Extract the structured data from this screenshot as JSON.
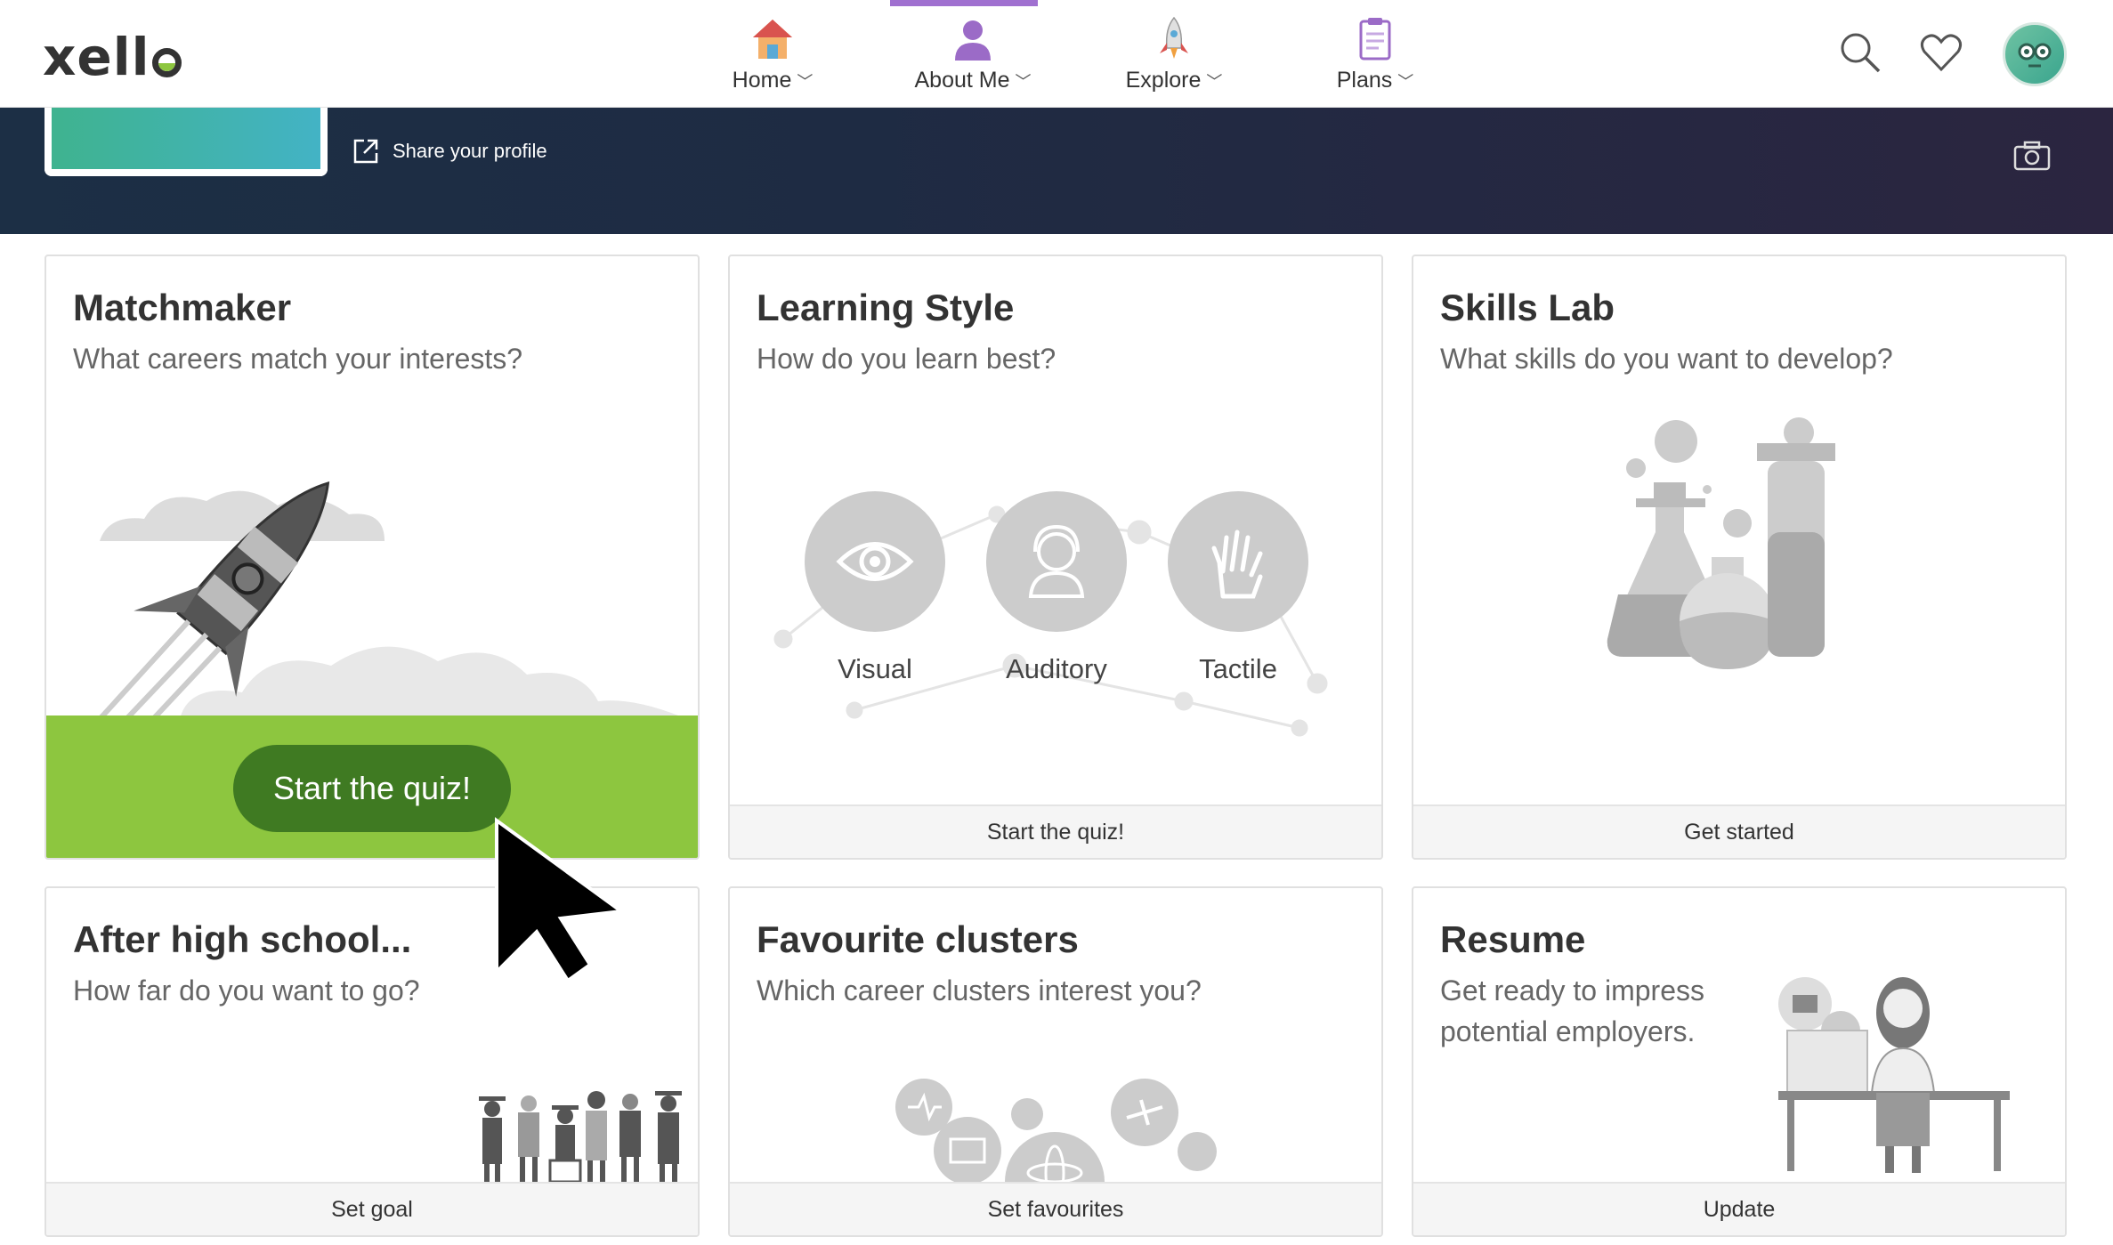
{
  "app": {
    "logo": "xello"
  },
  "nav": {
    "items": [
      {
        "label": "Home",
        "icon": "house-icon"
      },
      {
        "label": "About Me",
        "icon": "person-icon"
      },
      {
        "label": "Explore",
        "icon": "rocket-icon"
      },
      {
        "label": "Plans",
        "icon": "clipboard-icon"
      }
    ],
    "active": "About Me",
    "accent": "#a070d0"
  },
  "banner": {
    "share_label": "Share your profile"
  },
  "cards": {
    "matchmaker": {
      "title": "Matchmaker",
      "subtitle": "What careers match your interests?",
      "button": "Start the quiz!"
    },
    "learning": {
      "title": "Learning Style",
      "subtitle": "How do you learn best?",
      "styles": [
        "Visual",
        "Auditory",
        "Tactile"
      ],
      "footer": "Start the quiz!"
    },
    "skills": {
      "title": "Skills Lab",
      "subtitle": "What skills do you want to develop?",
      "footer": "Get started"
    },
    "after": {
      "title": "After high school...",
      "subtitle": "How far do you want to go?",
      "footer": "Set goal"
    },
    "clusters": {
      "title": "Favourite clusters",
      "subtitle": "Which career clusters interest you?",
      "footer": "Set favourites"
    },
    "resume": {
      "title": "Resume",
      "subtitle_line1": "Get ready to impress",
      "subtitle_line2": "potential employers.",
      "footer": "Update"
    }
  },
  "colors": {
    "green": "#8dc63f",
    "dark_green": "#3f7a22",
    "banner": "#1e2b43"
  }
}
